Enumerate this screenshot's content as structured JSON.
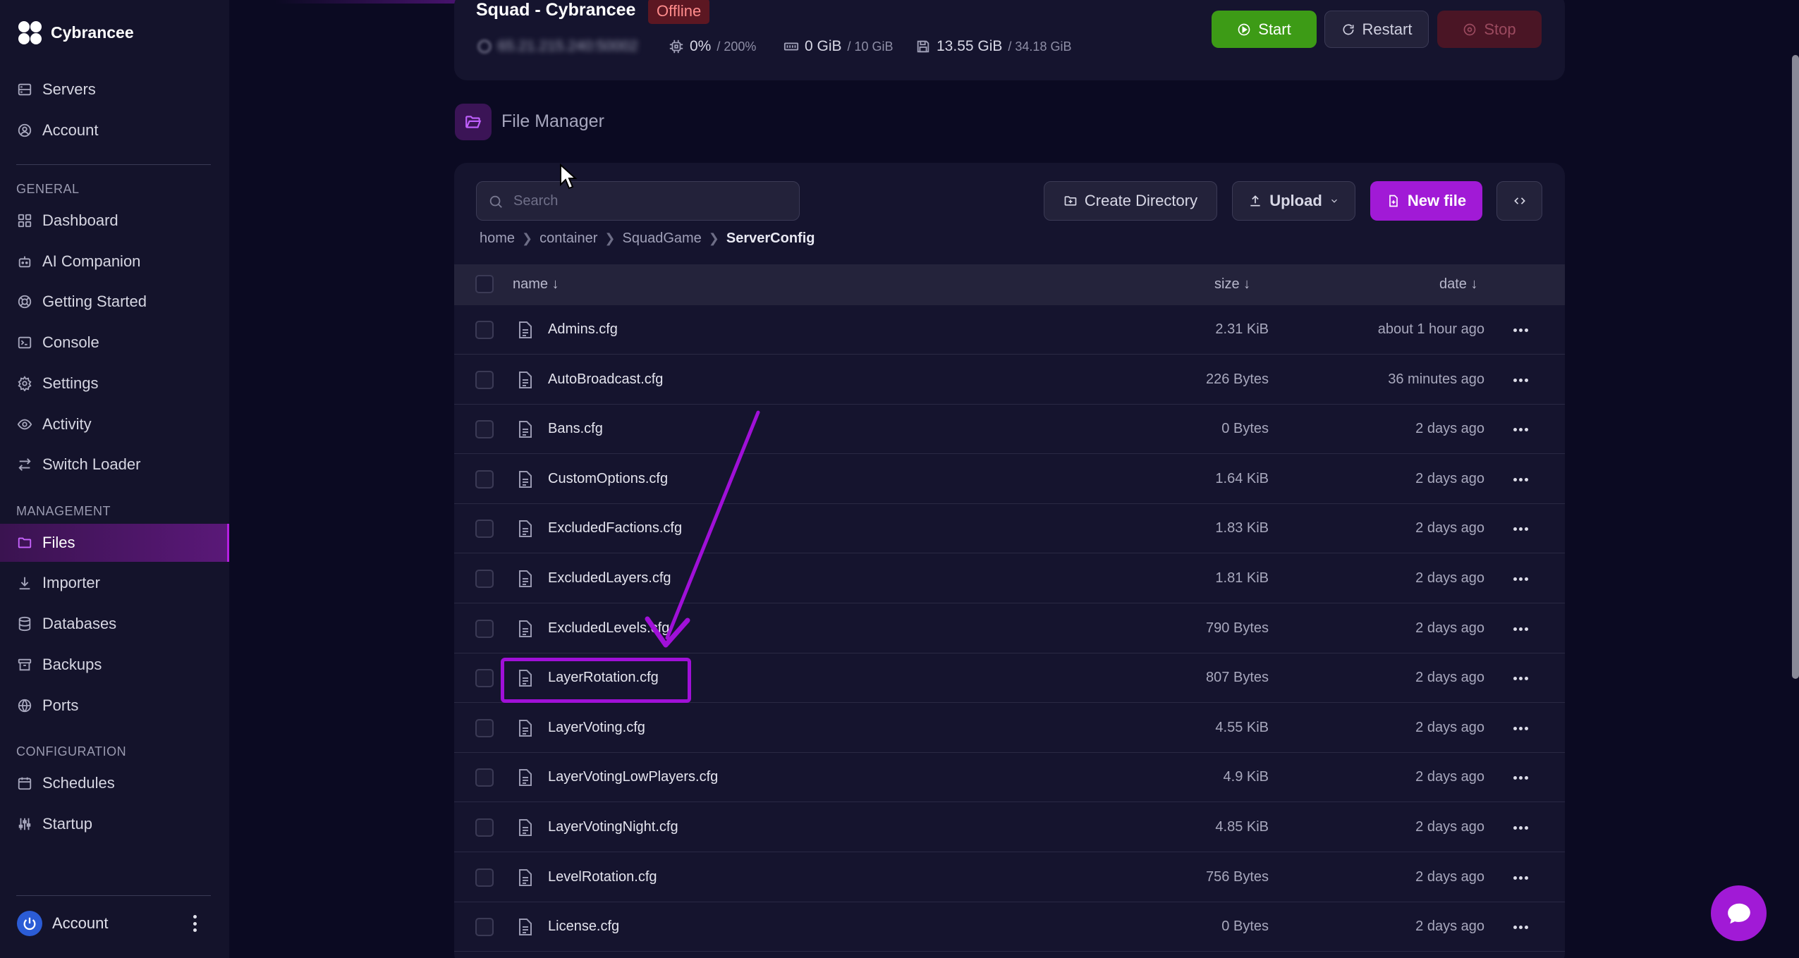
{
  "sidebar": {
    "brand": "Cybrancee",
    "top_items": [
      {
        "label": "Servers",
        "icon": "server-icon"
      },
      {
        "label": "Account",
        "icon": "user-circle-icon"
      }
    ],
    "sections": [
      {
        "label": "GENERAL",
        "items": [
          {
            "label": "Dashboard",
            "icon": "grid-icon"
          },
          {
            "label": "AI Companion",
            "icon": "robot-icon"
          },
          {
            "label": "Getting Started",
            "icon": "lifebuoy-icon"
          },
          {
            "label": "Console",
            "icon": "terminal-icon"
          },
          {
            "label": "Settings",
            "icon": "gear-icon"
          },
          {
            "label": "Activity",
            "icon": "eye-icon"
          },
          {
            "label": "Switch Loader",
            "icon": "switch-icon"
          }
        ]
      },
      {
        "label": "MANAGEMENT",
        "items": [
          {
            "label": "Files",
            "icon": "folder-icon",
            "active": true
          },
          {
            "label": "Importer",
            "icon": "download-icon"
          },
          {
            "label": "Databases",
            "icon": "database-icon"
          },
          {
            "label": "Backups",
            "icon": "archive-icon"
          },
          {
            "label": "Ports",
            "icon": "network-icon"
          }
        ]
      },
      {
        "label": "CONFIGURATION",
        "items": [
          {
            "label": "Schedules",
            "icon": "calendar-icon"
          },
          {
            "label": "Startup",
            "icon": "sliders-icon"
          }
        ]
      }
    ],
    "account_label": "Account"
  },
  "server": {
    "title": "Squad - Cybrancee",
    "status": "Offline",
    "ip": "65.21.215.240:50002",
    "cpu": "0%",
    "cpu_limit": "/ 200%",
    "memory": "0 GiB",
    "memory_limit": "/ 10 GiB",
    "disk": "13.55 GiB",
    "disk_limit": "/ 34.18 GiB",
    "start_label": "Start",
    "restart_label": "Restart",
    "stop_label": "Stop"
  },
  "file_manager": {
    "title": "File Manager",
    "search_placeholder": "Search",
    "create_directory_label": "Create Directory",
    "upload_label": "Upload",
    "new_file_label": "New file",
    "breadcrumb": [
      "home",
      "container",
      "SquadGame",
      "ServerConfig"
    ],
    "columns": {
      "name": "name ↓",
      "size": "size ↓",
      "date": "date ↓"
    },
    "files": [
      {
        "name": "Admins.cfg",
        "size": "2.31 KiB",
        "date": "about 1 hour ago"
      },
      {
        "name": "AutoBroadcast.cfg",
        "size": "226 Bytes",
        "date": "36 minutes ago"
      },
      {
        "name": "Bans.cfg",
        "size": "0 Bytes",
        "date": "2 days ago"
      },
      {
        "name": "CustomOptions.cfg",
        "size": "1.64 KiB",
        "date": "2 days ago"
      },
      {
        "name": "ExcludedFactions.cfg",
        "size": "1.83 KiB",
        "date": "2 days ago"
      },
      {
        "name": "ExcludedLayers.cfg",
        "size": "1.81 KiB",
        "date": "2 days ago"
      },
      {
        "name": "ExcludedLevels.cfg",
        "size": "790 Bytes",
        "date": "2 days ago"
      },
      {
        "name": "LayerRotation.cfg",
        "size": "807 Bytes",
        "date": "2 days ago"
      },
      {
        "name": "LayerVoting.cfg",
        "size": "4.55 KiB",
        "date": "2 days ago"
      },
      {
        "name": "LayerVotingLowPlayers.cfg",
        "size": "4.9 KiB",
        "date": "2 days ago"
      },
      {
        "name": "LayerVotingNight.cfg",
        "size": "4.85 KiB",
        "date": "2 days ago"
      },
      {
        "name": "LevelRotation.cfg",
        "size": "756 Bytes",
        "date": "2 days ago"
      },
      {
        "name": "License.cfg",
        "size": "0 Bytes",
        "date": "2 days ago"
      }
    ]
  },
  "colors": {
    "accent": "#a11ad6",
    "start": "#3d9b16",
    "offline": "#ff8c8c",
    "background": "#0b0a22"
  }
}
